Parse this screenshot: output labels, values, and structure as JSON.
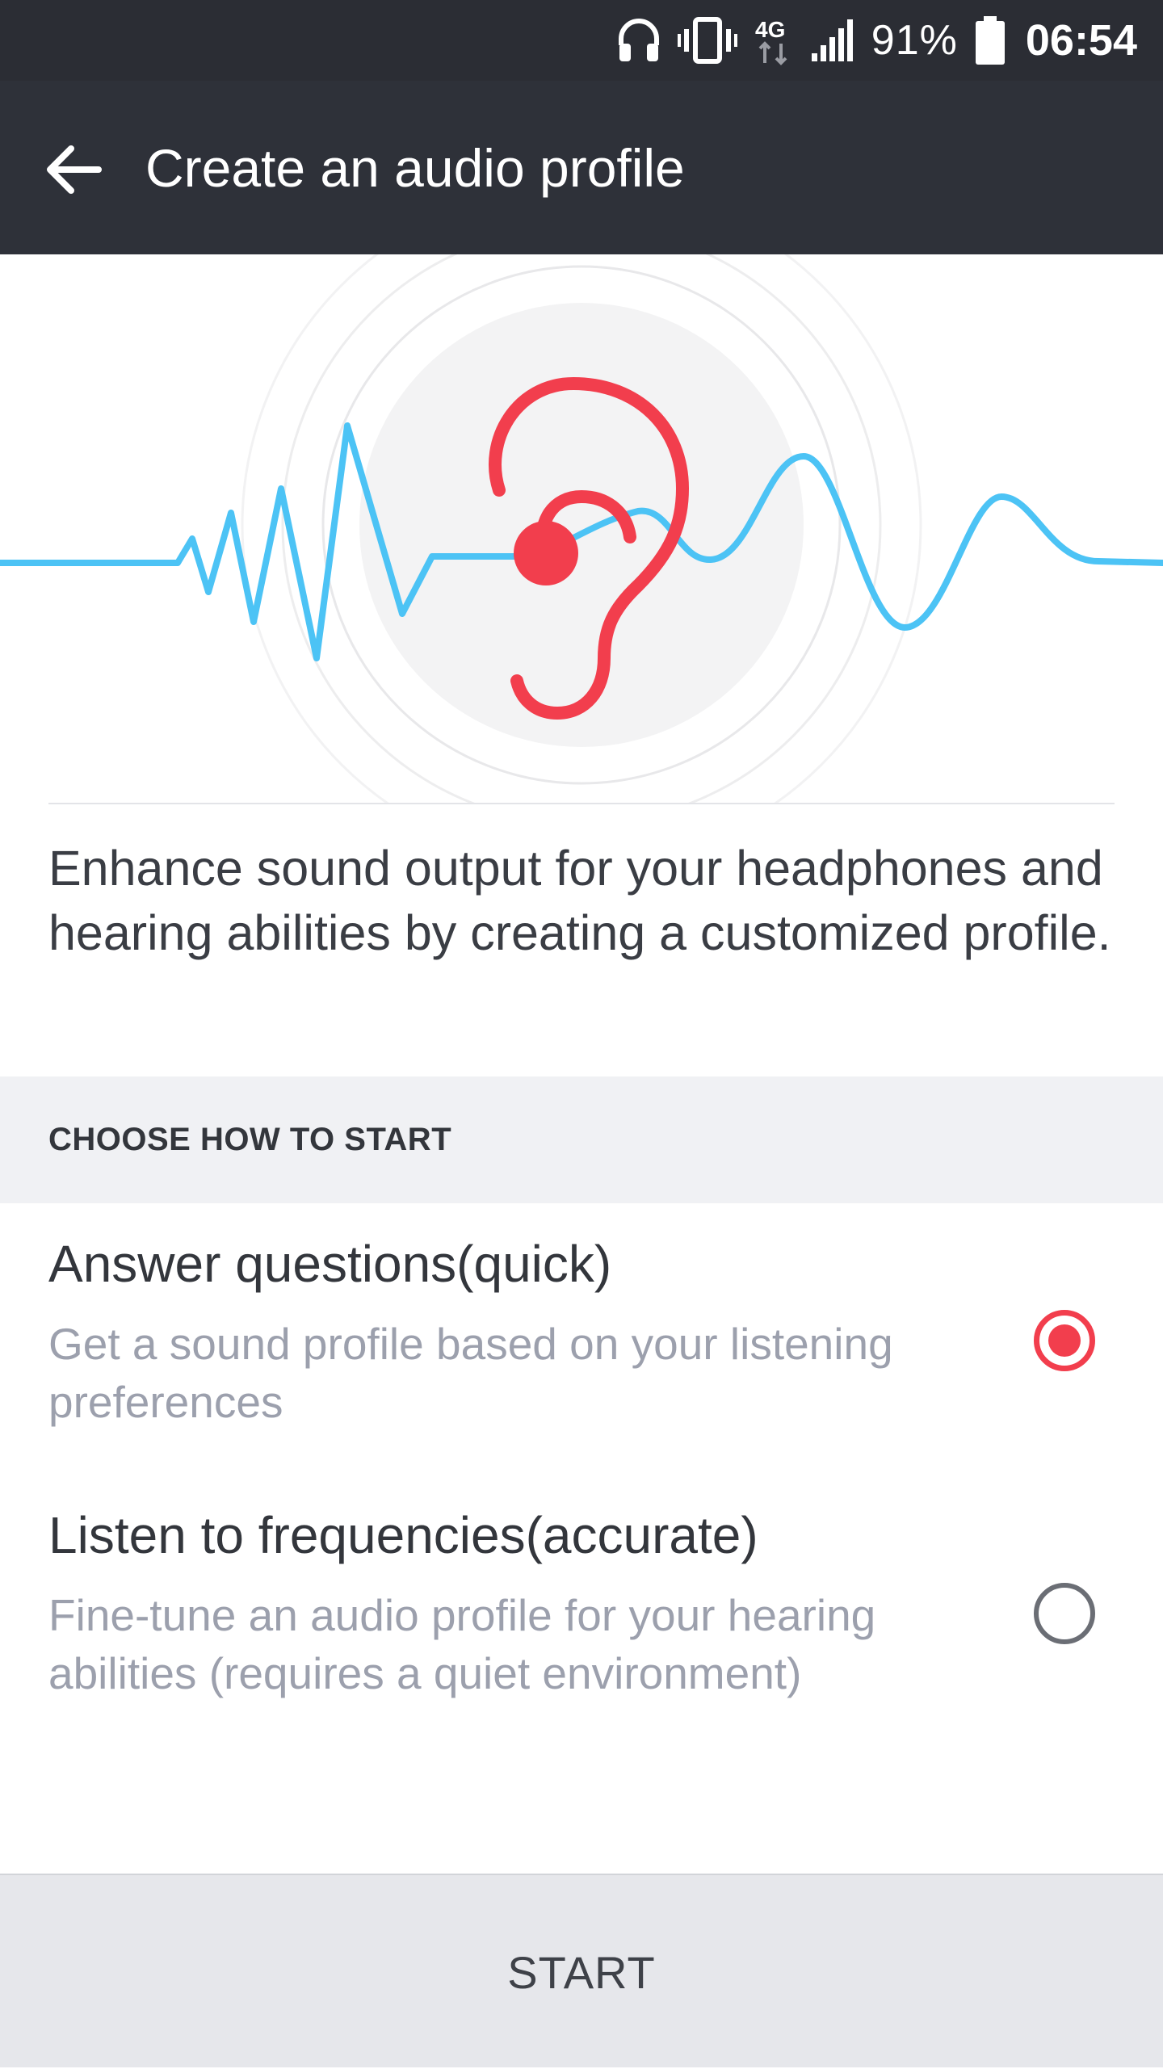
{
  "status_bar": {
    "icons": [
      "headphones-icon",
      "vibrate-icon",
      "4g-icon",
      "signal-icon",
      "battery-icon"
    ],
    "network_label": "4G",
    "battery": "91%",
    "time": "06:54"
  },
  "app_bar": {
    "back_icon": "back-arrow-icon",
    "title": "Create an audio profile"
  },
  "hero": {
    "icon": "ear-icon",
    "colors": {
      "ear": "#f23e4d",
      "wave": "#4cc3f5",
      "circle": "#f3f3f4"
    }
  },
  "description": "Enhance sound output for your headphones and hearing abilities by creating a customized profile.",
  "section_header": "CHOOSE HOW TO START",
  "options": [
    {
      "title": "Answer questions(quick)",
      "description": "Get a sound profile based on your listening preferences",
      "selected": true
    },
    {
      "title": "Listen to frequencies(accurate)",
      "description": "Fine-tune an audio profile for your hearing abilities (requires a quiet environment)",
      "selected": false
    }
  ],
  "actions": {
    "start_label": "START"
  },
  "colors": {
    "accent": "#f23e4d",
    "app_bar": "#2e3139",
    "status_bar": "#2b2d34"
  }
}
